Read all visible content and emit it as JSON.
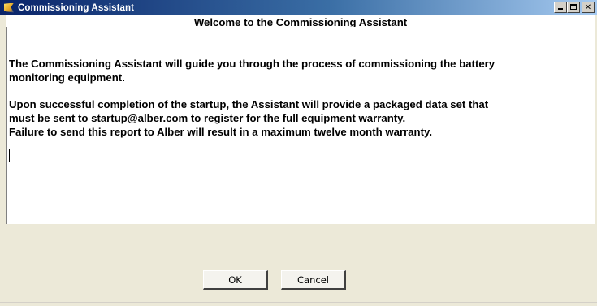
{
  "window": {
    "title": "Commissioning Assistant",
    "app_icon": "alber-logo-icon",
    "caption_buttons": [
      "minimize-icon",
      "maximize-icon",
      "close-icon"
    ]
  },
  "content": {
    "heading": "Welcome to the Commissioning Assistant",
    "paragraph1_line1": "The Commissioning Assistant will guide you through the process of commissioning the battery",
    "paragraph1_line2": "monitoring equipment.",
    "paragraph2_line1": "Upon successful completion of the startup, the Assistant will provide a packaged data set that",
    "paragraph2_line2": "must be sent to startup@alber.com to register for the full equipment warranty.",
    "paragraph2_line3": "Failure to send this report to Alber will result in a maximum twelve month warranty."
  },
  "buttons": {
    "ok_label": "OK",
    "cancel_label": "Cancel"
  },
  "colors": {
    "titlebar_start": "#0a246a",
    "titlebar_end": "#a6caf0",
    "dialog_background": "#ece9d8",
    "text_area_background": "#ffffff"
  }
}
